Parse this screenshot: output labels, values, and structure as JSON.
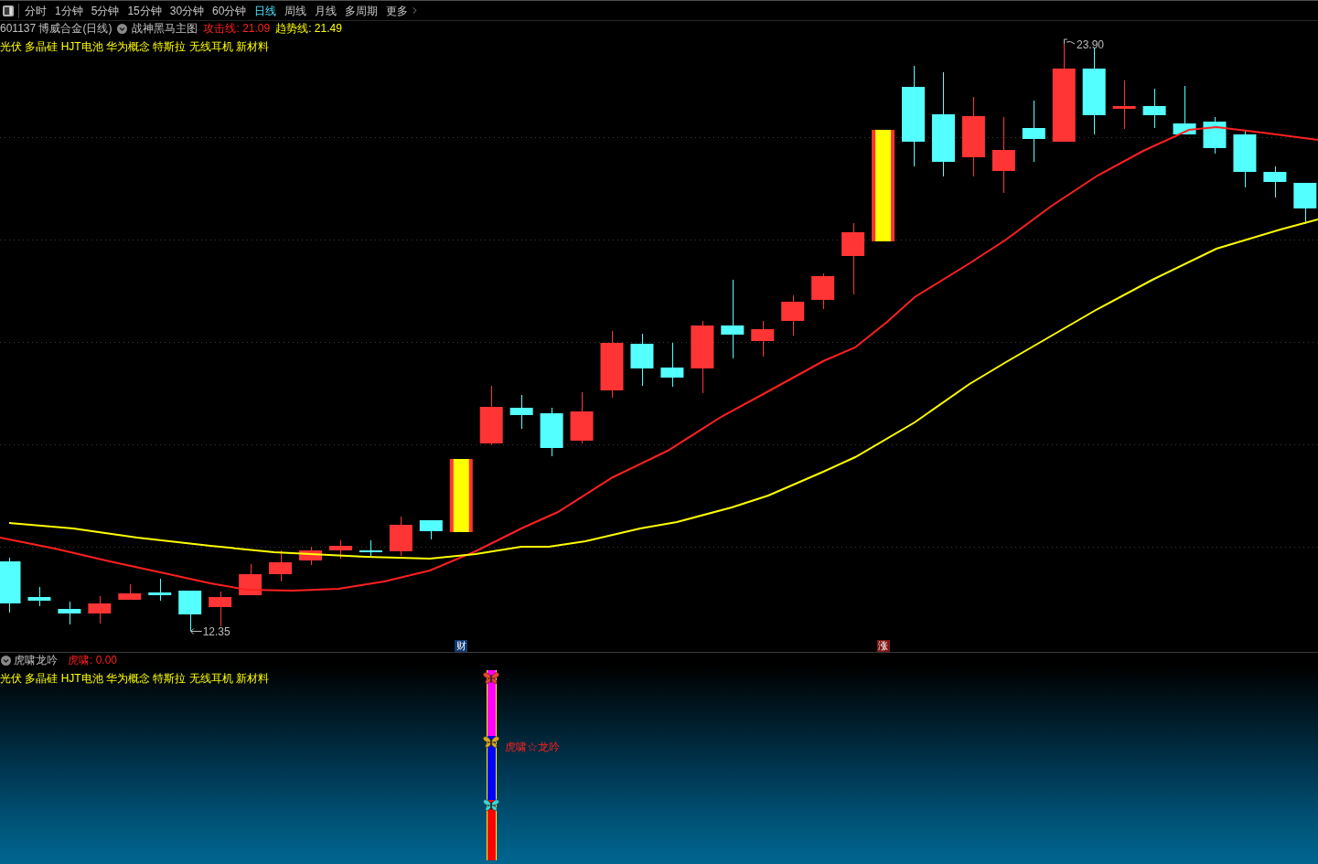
{
  "toolbar": {
    "periods": [
      {
        "label": "分时",
        "selected": false
      },
      {
        "label": "1分钟",
        "selected": false
      },
      {
        "label": "5分钟",
        "selected": false
      },
      {
        "label": "15分钟",
        "selected": false
      },
      {
        "label": "30分钟",
        "selected": false
      },
      {
        "label": "60分钟",
        "selected": false
      },
      {
        "label": "日线",
        "selected": true
      },
      {
        "label": "周线",
        "selected": false
      },
      {
        "label": "月线",
        "selected": false
      },
      {
        "label": "多周期",
        "selected": false
      }
    ],
    "more": {
      "label": "更多"
    }
  },
  "main_chart": {
    "title": "601137 博威合金(日线)",
    "indicator": "战神黑马主图",
    "lines": [
      {
        "label": "攻击线: 21.09",
        "color": "#ff2020"
      },
      {
        "label": "趋势线: 21.49",
        "color": "#ffff00"
      }
    ],
    "concepts": "光伏 多晶硅 HJT电池 华为概念 特斯拉 无线耳机 新材料",
    "price_labels": {
      "high": "23.90",
      "low": "12.35"
    },
    "markers": [
      {
        "label": "财",
        "color": "#0e3a70"
      },
      {
        "label": "涨",
        "color": "#7e1616"
      }
    ]
  },
  "sub_chart": {
    "indicator": "虎啸龙吟",
    "reading": "虎啸: 0.00",
    "concepts": "光伏 多晶硅 HJT电池 华为概念 特斯拉 无线耳机 新材料",
    "signal_label": "虎啸☆龙吟"
  }
}
